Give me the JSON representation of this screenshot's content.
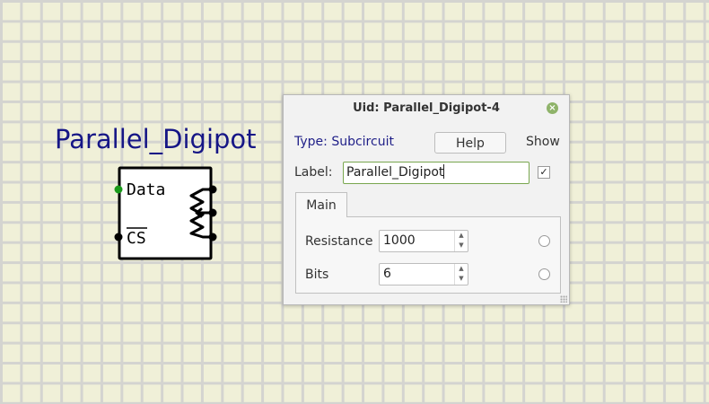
{
  "component": {
    "title": "Parallel_Digipot",
    "pin_data": "Data",
    "pin_cs": "CS"
  },
  "dialog": {
    "title": "Uid: Parallel_Digipot-4",
    "type_label": "Type: Subcircuit",
    "help_button": "Help",
    "show_label": "Show",
    "label_caption": "Label:",
    "label_value": "Parallel_Digipot",
    "show_checked": true,
    "tabs": [
      {
        "label": "Main",
        "active": true
      }
    ],
    "properties": [
      {
        "name": "Resistance",
        "value": "1000",
        "show": false
      },
      {
        "name": "Bits",
        "value": "6",
        "show": false
      }
    ]
  },
  "colors": {
    "background": "#f0f0d8",
    "grid": "#d4d4d0",
    "title_text": "#161686",
    "pin_active": "#1a9a1a",
    "input_focus_border": "#79a74f",
    "close_button": "#8fb36a"
  },
  "icons": {
    "close": "close-icon",
    "spin_up": "chevron-up-icon",
    "spin_down": "chevron-down-icon",
    "checkbox": "check-icon"
  }
}
